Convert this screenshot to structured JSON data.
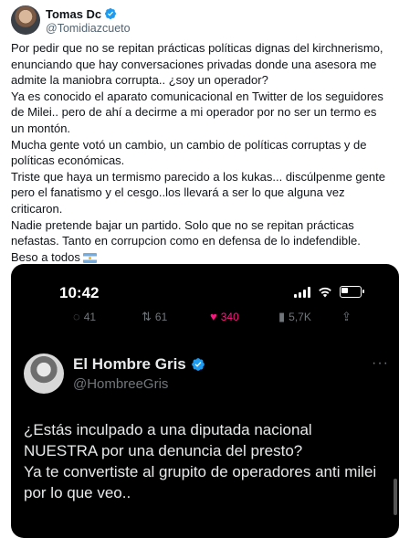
{
  "tweet": {
    "display_name": "Tomas Dc",
    "handle": "@Tomidiazcueto",
    "paragraphs": [
      "Por pedir que no se repitan prácticas políticas dignas del kirchnerismo, enunciando que hay conversaciones privadas donde una asesora me admite la maniobra corrupta.. ¿soy un operador?",
      "Ya es conocido el aparato comunicacional en Twitter de los seguidores de Milei.. pero de ahí a decirme a mi operador por no ser un termo es un montón.",
      "Mucha gente votó un cambio, un cambio de políticas corruptas y de políticas económicas.",
      "Triste que haya un termismo parecido a los kukas... discúlpenme gente pero el fanatismo y el cesgo..los llevará a ser lo que alguna vez criticaron.",
      "Nadie pretende bajar un partido. Solo que no se repitan prácticas nefastas. Tanto en corrupcion como en defensa de lo indefendible.",
      "Beso a todos"
    ],
    "flag_icon": "argentina-flag-icon"
  },
  "screenshot": {
    "status_time": "10:42",
    "action_counts": {
      "replies": "41",
      "retweets": "61",
      "likes": "340",
      "views": "5,7K"
    },
    "inner_tweet": {
      "display_name": "El Hombre Gris",
      "handle": "@HombreeGris",
      "text_lines": [
        "¿Estás inculpado a una diputada nacional NUESTRA por una denuncia del presto?",
        "Ya te convertiste al grupito de operadores anti milei por lo que veo.."
      ]
    }
  },
  "colors": {
    "verified_blue": "#1d9bf0",
    "text_primary": "#0f1419",
    "text_secondary": "#536471",
    "like_pink": "#f91880",
    "dark_bg": "#000000"
  }
}
